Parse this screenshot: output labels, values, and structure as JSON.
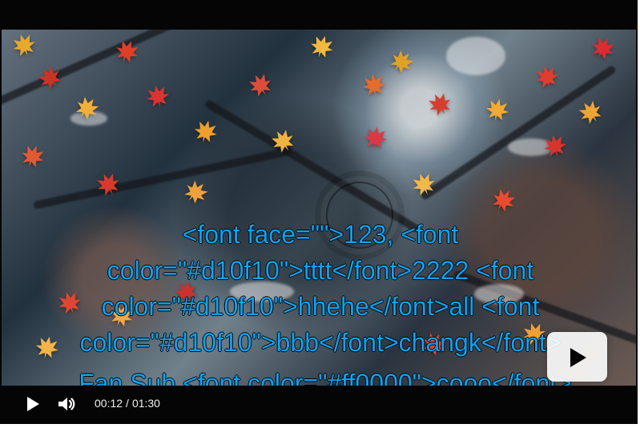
{
  "video": {
    "subtitles": {
      "main": "<font face=\"\">123, <font color=\"#d10f10\">tttt</font>2222 <font color=\"#d10f10\">hhehe</font>all <font color=\"#d10f10\">bbb</font>changk</font>",
      "fan_sub": "Fan Sub <font color=\"#ff0000\">cooo</font>"
    },
    "center_control": {
      "icon": "play-icon"
    }
  },
  "controls": {
    "play_icon": "play-icon",
    "volume_icon": "volume-icon",
    "current_time": "00:12",
    "separator": "/",
    "duration": "01:30",
    "progress": 0.1333,
    "colors": {
      "progress": "#f01818",
      "subtitle": "#0ea2f2",
      "control_background": "#050505"
    }
  }
}
